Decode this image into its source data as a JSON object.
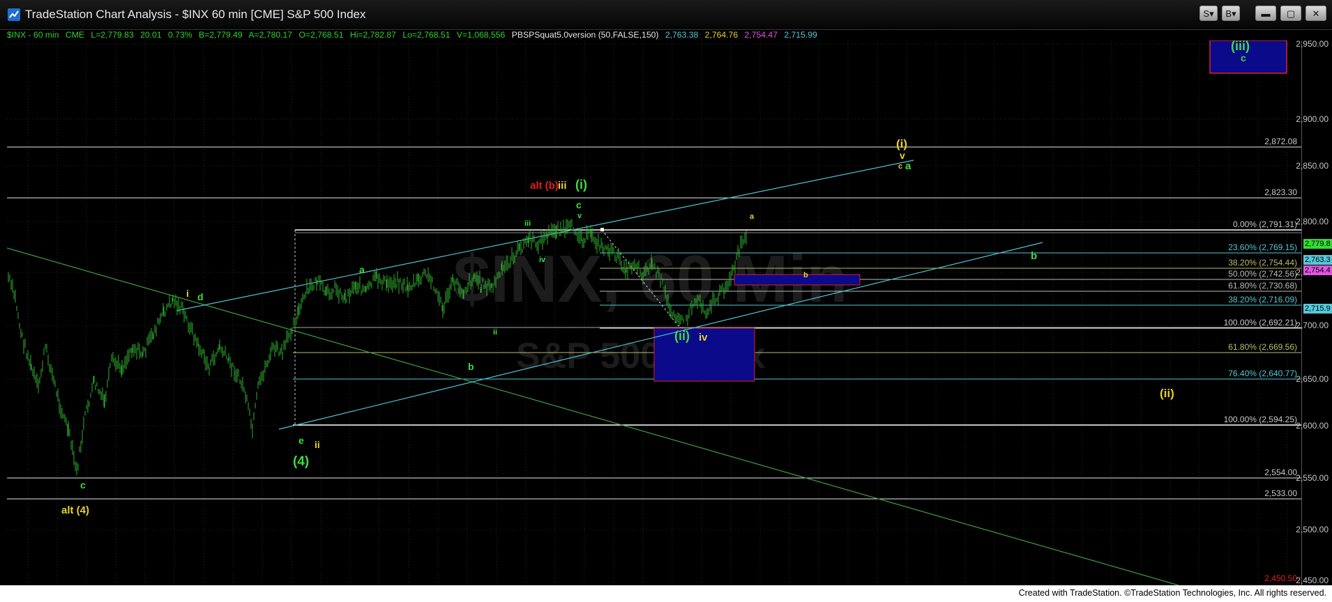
{
  "window": {
    "title": "TradeStation Chart Analysis - $INX 60 min [CME] S&P 500 Index",
    "buttons": {
      "s_menu": "S",
      "b_menu": "B",
      "minimize": "▬",
      "maximize": "▢",
      "close": "✕"
    }
  },
  "infobar": {
    "symbol": "$INX - 60 min",
    "exchange": "CME",
    "last": "L=2,779.83",
    "change": "20.01",
    "pct_change": "0.73%",
    "bid": "B=2,779.49",
    "ask": "A=2,780.17",
    "open": "O=2,768.51",
    "high": "Hi=2,782.87",
    "low": "Lo=2,768.51",
    "volume": "V=1,068,556",
    "study": "PBSPSquat5.0version (50,FALSE,150)",
    "study_values": [
      "2,763.38",
      "2,764.76",
      "2,754.47",
      "2,715.99"
    ]
  },
  "watermark": {
    "symbol": "$INX, 60 Min",
    "name": "S&P 500 Index"
  },
  "axis": {
    "labels": [
      "2,950.00",
      "2,900.00",
      "2,850.00",
      "2,800.00",
      "2,750.00",
      "2,700.00",
      "2,650.00",
      "2,600.00",
      "2,550.00",
      "2,500.00",
      "2,450.00"
    ],
    "price_tags": [
      {
        "text": "2,779.8",
        "color": "#33dd33"
      },
      {
        "text": "2,763.3",
        "color": "#55c8d8"
      },
      {
        "text": "2,754.4",
        "color": "#e055e0"
      },
      {
        "text": "2,715.9",
        "color": "#55c8d8"
      }
    ]
  },
  "levels": {
    "lines": [
      "2,872.08",
      "2,823.30",
      "2,554.00",
      "2,533.00",
      "2,450.50"
    ],
    "fib_upper": [
      "0.00% (2,791.31)",
      "23.60% (2,769.15)",
      "38.20% (2,754.44)",
      "50.00% (2,742.56)",
      "61.80% (2,730.68)",
      "38.20% (2,716.09)",
      "100.00% (2,692.21)"
    ],
    "fib_lower": [
      "61.80% (2,669.56)",
      "76.40% (2,640.77)",
      "100.00% (2,594.25)"
    ]
  },
  "wave_labels": {
    "yellow": [
      "alt (4)",
      "i",
      "ii",
      "iii",
      "a",
      "(i)",
      "v",
      "c",
      "iv",
      "(ii)"
    ],
    "green": [
      "c",
      "d",
      "e",
      "(4)",
      "a",
      "b",
      "iii",
      "iv",
      "i",
      "ii",
      "(i)",
      "c",
      "v",
      "(ii)",
      "a",
      "b",
      "(iii)",
      "c"
    ],
    "red": [
      "alt (b)"
    ],
    "box_label": "b"
  },
  "footer": "Created with TradeStation. ©TradeStation Technologies, Inc. All rights reserved.",
  "colors": {
    "background": "#000000",
    "price_bars": "#2fb02f",
    "channel": "#4fc3d6",
    "trendline": "#3f9f3f",
    "fib_box": "#0a0a8a",
    "fib_box_border": "#e02020",
    "yellow_label": "#e6d22a",
    "green_label": "#3fdc3f",
    "red_label": "#e02020"
  }
}
